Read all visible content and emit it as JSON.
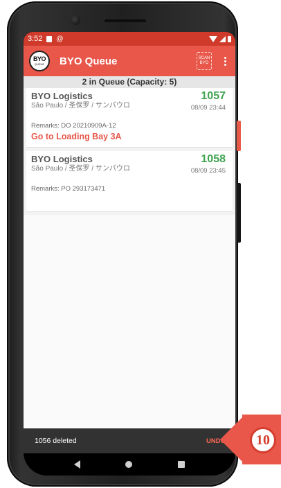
{
  "status_bar": {
    "time": "3:52",
    "icons": [
      "sd-card-icon",
      "at-icon",
      "wifi-icon",
      "signal-icon",
      "battery-icon"
    ]
  },
  "app_bar": {
    "logo_text": "BYO",
    "logo_subtext": "QUEUE",
    "title": "BYO Queue",
    "scan_icon_lines": [
      "SCAN",
      "BYO"
    ]
  },
  "queue": {
    "header": "2 in Queue (Capacity: 5)",
    "items": [
      {
        "company": "BYO Logistics",
        "city": "São Paulo / 圣保罗 / サンパウロ",
        "ticket": "1057",
        "time": "08/09 23:44",
        "remarks": "Remarks: DO 20210909A-12",
        "instruction": "Go to Loading Bay 3A"
      },
      {
        "company": "BYO Logistics",
        "city": "São Paulo / 圣保罗 / サンパウロ",
        "ticket": "1058",
        "time": "08/09 23:45",
        "remarks": "Remarks: PO 293173471"
      }
    ]
  },
  "snackbar": {
    "message": "1056 deleted",
    "action": "UNDO"
  },
  "callout": {
    "number": "10"
  },
  "colors": {
    "primary": "#e8574a",
    "status_bar": "#cf3a2b",
    "ticket_green": "#3fa350",
    "snackbar_bg": "#323232"
  }
}
